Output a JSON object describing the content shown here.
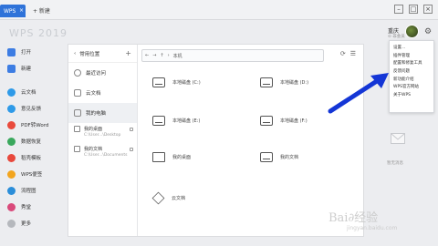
{
  "titlebar": {
    "tab_label": "WPS",
    "new_tab_label": "+ 新建"
  },
  "app": {
    "logo": "WPS 2019"
  },
  "nav": {
    "items": [
      {
        "label": "打开",
        "color": "#3d7de3"
      },
      {
        "label": "新建",
        "color": "#3d7de3"
      },
      {
        "label": "云文档",
        "color": "#2e9ae8"
      },
      {
        "label": "意见反馈",
        "color": "#2e9ae8"
      },
      {
        "label": "PDF转Word",
        "color": "#e94a3c"
      },
      {
        "label": "数据恢复",
        "color": "#3aa85d"
      },
      {
        "label": "稻壳模板",
        "color": "#e8483c"
      },
      {
        "label": "WPS便签",
        "color": "#f2a51f"
      },
      {
        "label": "流程图",
        "color": "#2b8ed9"
      },
      {
        "label": "秀堂",
        "color": "#d94a7b"
      },
      {
        "label": "更多",
        "color": "#b5b8bd"
      }
    ]
  },
  "sidebar": {
    "header": "常用位置",
    "items": [
      {
        "label": "最近访问"
      },
      {
        "label": "云文档"
      },
      {
        "label": "我的电脑"
      }
    ],
    "pinned": [
      {
        "label": "我的桌面",
        "path": "C:\\User...\\Desktop"
      },
      {
        "label": "我的文档",
        "path": "C:\\User...\\Documents"
      }
    ]
  },
  "toolbar": {
    "path": "本机"
  },
  "drives": [
    {
      "label": "本地磁盘 (C:)"
    },
    {
      "label": "本地磁盘 (D:)"
    },
    {
      "label": "本地磁盘 (E:)"
    },
    {
      "label": "本地磁盘 (F:)"
    },
    {
      "label": "我的桌面"
    },
    {
      "label": "我的文档"
    },
    {
      "label": "云文档"
    }
  ],
  "user": {
    "name": "重庆",
    "sub": "⊙ 非会员"
  },
  "menu": {
    "items": [
      {
        "label": "设置..."
      },
      {
        "label": "插件管理"
      },
      {
        "label": "配置和修复工具"
      },
      {
        "label": "反馈问题"
      },
      {
        "label": "新功能介绍"
      },
      {
        "label": "WPS官方网站"
      },
      {
        "label": "关于WPS"
      }
    ]
  },
  "notice": {
    "text": "暂无消息"
  },
  "watermark": {
    "main": "Bai∂经验",
    "sub": "jingyan.baidu.com"
  },
  "colors": {
    "accent": "#2f73d9",
    "arrow": "#1436d6"
  }
}
